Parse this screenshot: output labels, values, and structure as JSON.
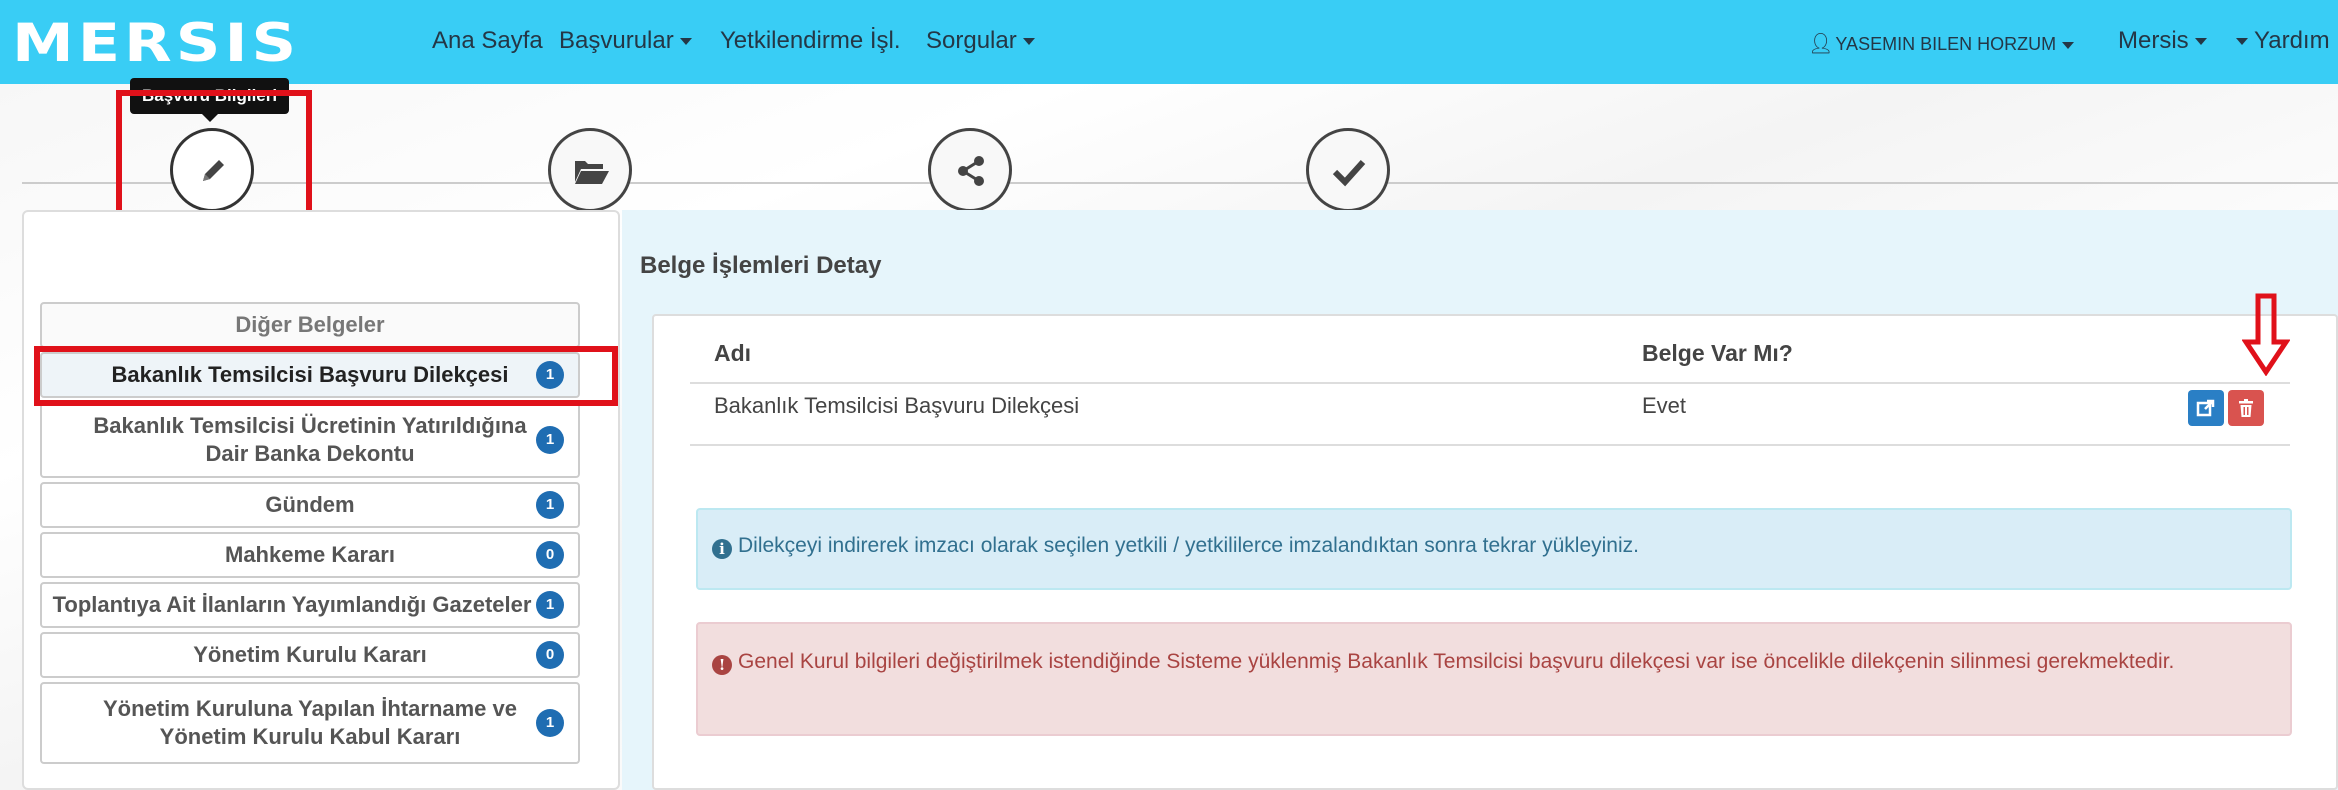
{
  "brand": {
    "logo_text": "MERSIS",
    "navbar_color": "#39cdf5"
  },
  "nav": {
    "home": "Ana Sayfa",
    "applications": "Başvurular",
    "authorization": "Yetkilendirme İşl.",
    "queries": "Sorgular",
    "user": "YASEMIN BILEN HORZUM",
    "mersis": "Mersis",
    "help": "Yardım"
  },
  "steps": {
    "tooltip": "Başvuru Bilgileri",
    "items": [
      {
        "icon": "pencil-icon",
        "active": true
      },
      {
        "icon": "folder-open-icon",
        "active": false
      },
      {
        "icon": "share-icon",
        "active": false
      },
      {
        "icon": "check-icon",
        "active": false
      }
    ]
  },
  "documents": {
    "header": "Diğer Belgeler",
    "items": [
      {
        "label": "Bakanlık Temsilcisi Başvuru Dilekçesi",
        "count": "1",
        "active": true
      },
      {
        "label": "Bakanlık Temsilcisi Ücretinin Yatırıldığına Dair Banka Dekontu",
        "count": "1"
      },
      {
        "label": "Gündem",
        "count": "1"
      },
      {
        "label": "Mahkeme Kararı",
        "count": "0"
      },
      {
        "label": "Toplantıya Ait İlanların Yayımlandığı Gazeteler",
        "count": "1"
      },
      {
        "label": "Yönetim Kurulu Kararı",
        "count": "0"
      },
      {
        "label": "Yönetim Kuruluna Yapılan İhtarname ve Yönetim Kurulu Kabul Kararı",
        "count": "1"
      }
    ]
  },
  "detail": {
    "title": "Belge İşlemleri Detay",
    "columns": [
      "Adı",
      "Belge Var Mı?"
    ],
    "rows": [
      {
        "name": "Bakanlık Temsilcisi Başvuru Dilekçesi",
        "exists": "Evet"
      }
    ],
    "info_alert": "Dilekçeyi indirerek imzacı olarak seçilen yetkili / yetkililerce imzalandıktan sonra tekrar yükleyiniz.",
    "danger_alert": "Genel Kurul bilgileri değiştirilmek istendiğinde Sisteme yüklenmiş Bakanlık Temsilcisi başvuru dilekçesi var ise öncelikle dilekçenin silinmesi gerekmektedir."
  },
  "colors": {
    "highlight": "#e0111a",
    "badge": "#1f6db2",
    "edit_button": "#2a7fc5",
    "delete_button": "#d9534f"
  }
}
